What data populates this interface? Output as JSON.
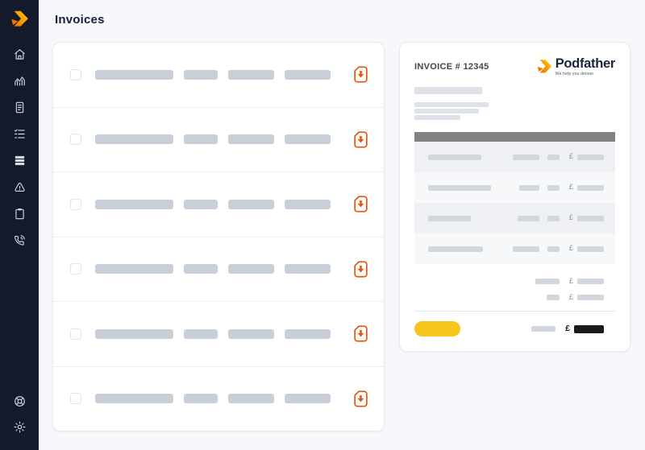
{
  "app": {
    "title": "Invoices"
  },
  "colors": {
    "sidebar_bg": "#131a2c",
    "accent_orange": "#e8570e",
    "brand_yellow_gradient": [
      "#f07300",
      "#ffd21f"
    ],
    "total_pill_yellow": "#f8c51c",
    "table_header_gray": "#828282",
    "brand_navy": "#1c2540"
  },
  "sidebar": {
    "logo_icon": "podfather-arrow-icon",
    "items": [
      {
        "icon": "home-icon"
      },
      {
        "icon": "chart-icon"
      },
      {
        "icon": "invoice-icon"
      },
      {
        "icon": "checklist-icon"
      },
      {
        "icon": "stack-icon"
      },
      {
        "icon": "alert-icon"
      },
      {
        "icon": "clipboard-icon"
      },
      {
        "icon": "phone-icon"
      }
    ],
    "footer_items": [
      {
        "icon": "help-icon"
      },
      {
        "icon": "settings-icon"
      }
    ]
  },
  "invoice_list": {
    "row_action_icon": "file-download-icon",
    "rows": [
      {
        "bars": [
          97,
          42,
          57,
          57
        ]
      },
      {
        "bars": [
          97,
          42,
          57,
          57
        ]
      },
      {
        "bars": [
          97,
          42,
          57,
          57
        ]
      },
      {
        "bars": [
          97,
          42,
          57,
          57
        ]
      },
      {
        "bars": [
          97,
          42,
          57,
          57
        ]
      },
      {
        "bars": [
          97,
          42,
          57,
          57
        ]
      }
    ]
  },
  "preview": {
    "title": "INVOICE # 12345",
    "brand": {
      "name": "Podfather",
      "tagline": "We help you deliver"
    },
    "currency": "£",
    "skeleton": {
      "heading_bar": 84,
      "address_lines": [
        92,
        80,
        57
      ]
    },
    "table_rows": [
      {
        "shade": "dark",
        "bars": {
          "desc": 66,
          "qty": 33,
          "unit": 15,
          "amount": 33
        }
      },
      {
        "shade": "light",
        "bars": {
          "desc": 78,
          "qty": 25,
          "unit": 15,
          "amount": 33
        }
      },
      {
        "shade": "dark",
        "bars": {
          "desc": 53,
          "qty": 27,
          "unit": 15,
          "amount": 33
        }
      },
      {
        "shade": "light",
        "bars": {
          "desc": 68,
          "qty": 33,
          "unit": 15,
          "amount": 33
        }
      }
    ],
    "summary_lines": [
      {
        "bars": {
          "label": 30,
          "amount": 33
        }
      },
      {
        "bars": {
          "label": 16,
          "amount": 33
        }
      }
    ],
    "total": {
      "pill_w": 57,
      "label_bar": 30,
      "amount_bar": 37
    }
  }
}
